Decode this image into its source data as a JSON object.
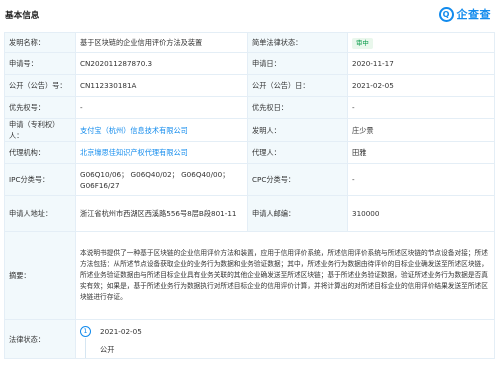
{
  "header": {
    "title": "基本信息",
    "logo_text": "企查查",
    "logo_mark": "Q"
  },
  "rows": {
    "name_label": "发明名称：",
    "name_value": "基于区块链的企业信用评价方法及装置",
    "legal_status_label": "简单法律状态：",
    "legal_status_value": "审中",
    "app_no_label": "申请号：",
    "app_no_value": "CN202011287870.3",
    "app_date_label": "申请日：",
    "app_date_value": "2020-11-17",
    "pub_no_label": "公开（公告）号：",
    "pub_no_value": "CN112330181A",
    "pub_date_label": "公开（公告）日：",
    "pub_date_value": "2021-02-05",
    "priority_no_label": "优先权号：",
    "priority_no_value": "-",
    "priority_date_label": "优先权日：",
    "priority_date_value": "-",
    "applicant_label": "申请（专利权）人：",
    "applicant_value": "支付宝（杭州）信息技术有限公司",
    "inventor_label": "发明人：",
    "inventor_value": "庄少景",
    "agency_label": "代理机构：",
    "agency_value": "北京壕思佳知识产权代理有限公司",
    "agent_label": "代理人：",
    "agent_value": "田雅",
    "ipc_label": "IPC分类号：",
    "ipc_value": "G06Q10/06； G06Q40/02； G06Q40/00； G06F16/27",
    "cpc_label": "CPC分类号：",
    "cpc_value": "-",
    "address_label": "申请人地址：",
    "address_value": "浙江省杭州市西湖区西溪路556号8层B段801-11",
    "postcode_label": "申请人邮编：",
    "postcode_value": "310000",
    "abstract_label": "摘要：",
    "abstract_value": "本说明书提供了一种基于区块链的企业信用评价方法和装置，应用于信用评价系统，所述信用评价系统与所述区块链的节点设备对接；所述方法包括：从所述节点设备获取企业的业务行为数据和业务验证数据；其中，所述业务行为数据由待评价的目标企业确发送至所述区块链，所述业务验证数据由与所述目标企业具有业务关联的其他企业确发送至所述区块链；基于所述业务验证数据，验证所述业务行为数据是否真实有效；如果是，基于所述业务行为数据执行对所述目标企业的信用评价计算，并将计算出的对所述目标企业的信用评价结果发送至所述区块链进行存证。",
    "status_label": "法律状态：",
    "status_index": "1",
    "status_date": "2021-02-05",
    "status_text": "公开"
  },
  "colors": {
    "accent": "#128bed",
    "label_bg": "#f2f9fc",
    "badge_bg": "#e9f7ec",
    "badge_text": "#009944",
    "border": "#e4eef6"
  }
}
